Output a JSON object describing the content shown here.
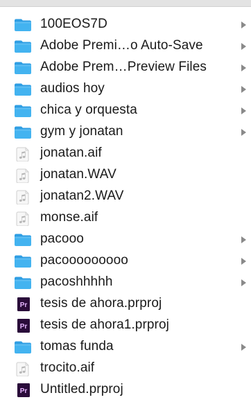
{
  "colors": {
    "folder_front": "#43b3f0",
    "folder_tab": "#2f9ee3",
    "prproj_bg": "#2a0b3a",
    "prproj_text": "#e6b6ff",
    "audio_bg": "#f6f6f6",
    "chevron": "#8a8a8a"
  },
  "items": [
    {
      "label": "100EOS7D",
      "type": "folder",
      "icon": "folder-icon",
      "has_children": true
    },
    {
      "label": "Adobe Premi…o Auto-Save",
      "type": "folder",
      "icon": "folder-icon",
      "has_children": true
    },
    {
      "label": "Adobe Prem…Preview Files",
      "type": "folder",
      "icon": "folder-icon",
      "has_children": true
    },
    {
      "label": "audios hoy",
      "type": "folder",
      "icon": "folder-icon",
      "has_children": true
    },
    {
      "label": "chica y orquesta",
      "type": "folder",
      "icon": "folder-icon",
      "has_children": true
    },
    {
      "label": "gym y jonatan",
      "type": "folder",
      "icon": "folder-icon",
      "has_children": true
    },
    {
      "label": "jonatan.aif",
      "type": "audio",
      "icon": "audio-file-icon",
      "has_children": false
    },
    {
      "label": "jonatan.WAV",
      "type": "audio",
      "icon": "audio-file-icon",
      "has_children": false
    },
    {
      "label": "jonatan2.WAV",
      "type": "audio",
      "icon": "audio-file-icon",
      "has_children": false
    },
    {
      "label": "monse.aif",
      "type": "audio",
      "icon": "audio-file-icon",
      "has_children": false
    },
    {
      "label": "pacooo",
      "type": "folder",
      "icon": "folder-icon",
      "has_children": true
    },
    {
      "label": "pacooooooooo",
      "type": "folder",
      "icon": "folder-icon",
      "has_children": true
    },
    {
      "label": "pacoshhhhh",
      "type": "folder",
      "icon": "folder-icon",
      "has_children": true
    },
    {
      "label": "tesis de ahora.prproj",
      "type": "prproj",
      "icon": "premiere-project-icon",
      "badge": "Pr",
      "has_children": false
    },
    {
      "label": "tesis de ahora1.prproj",
      "type": "prproj",
      "icon": "premiere-project-icon",
      "badge": "Pr",
      "has_children": false
    },
    {
      "label": "tomas funda",
      "type": "folder",
      "icon": "folder-icon",
      "has_children": true
    },
    {
      "label": "trocito.aif",
      "type": "audio",
      "icon": "audio-file-icon",
      "has_children": false
    },
    {
      "label": "Untitled.prproj",
      "type": "prproj",
      "icon": "premiere-project-icon",
      "badge": "Pr",
      "has_children": false
    }
  ]
}
